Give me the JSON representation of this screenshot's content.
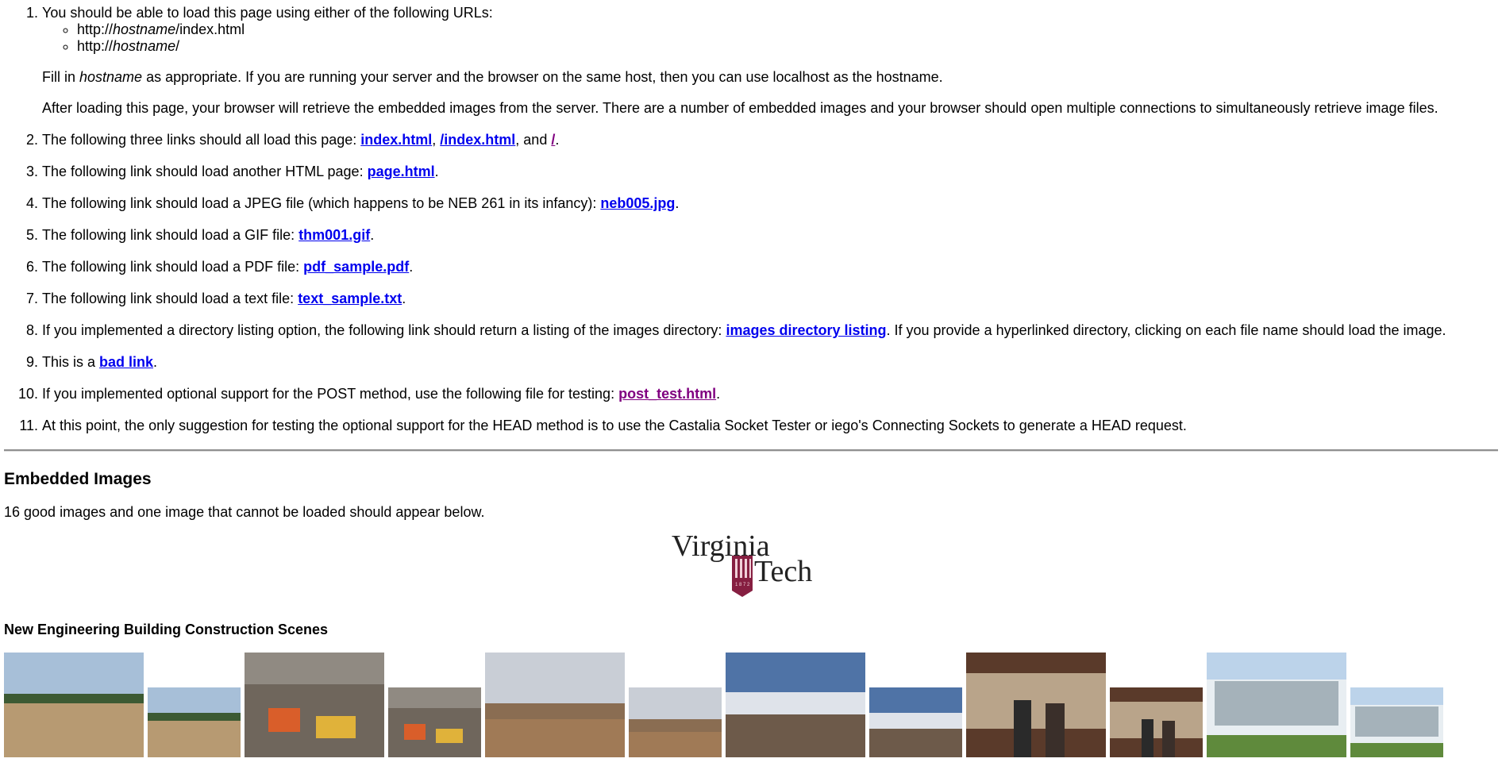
{
  "list": {
    "item1": {
      "text": "You should be able to load this page using either of the following URLs:",
      "urls": [
        {
          "prefix": "http://",
          "host": "hostname",
          "suffix": "/index.html"
        },
        {
          "prefix": "http://",
          "host": "hostname",
          "suffix": "/"
        }
      ],
      "fill_pre": "Fill in ",
      "fill_em": "hostname",
      "fill_post": " as appropriate. If you are running your server and the browser on the same host, then you can use localhost as the hostname.",
      "after": "After loading this page, your browser will retrieve the embedded images from the server. There are a number of embedded images and your browser should open multiple connections to simultaneously retrieve image files."
    },
    "item2": {
      "text": "The following three links should all load this page: ",
      "link1": "index.html",
      "sep1": ", ",
      "link2": "/index.html",
      "sep2": ", and ",
      "link3": "/",
      "end": "."
    },
    "item3": {
      "text": "The following link should load another HTML page: ",
      "link": "page.html",
      "end": "."
    },
    "item4": {
      "text": "The following link should load a JPEG file (which happens to be NEB 261 in its infancy): ",
      "link": "neb005.jpg",
      "end": "."
    },
    "item5": {
      "text": "The following link should load a GIF file: ",
      "link": "thm001.gif",
      "end": "."
    },
    "item6": {
      "text": "The following link should load a PDF file: ",
      "link": "pdf_sample.pdf",
      "end": "."
    },
    "item7": {
      "text": "The following link should load a text file: ",
      "link": "text_sample.txt",
      "end": "."
    },
    "item8": {
      "text": "If you implemented a directory listing option, the following link should return a listing of the images directory: ",
      "link": "images directory listing",
      "end": ". If you provide a hyperlinked directory, clicking on each file name should load the image."
    },
    "item9": {
      "text": "This is a ",
      "link": "bad link",
      "end": "."
    },
    "item10": {
      "text": "If you implemented optional support for the POST method, use the following file for testing: ",
      "link": "post_test.html",
      "end": "."
    },
    "item11": {
      "text": "At this point, the only suggestion for testing the optional support for the HEAD method is to use the Castalia Socket Tester or iego's Connecting Sockets to generate a HEAD request."
    }
  },
  "embedded": {
    "heading": "Embedded Images",
    "description": "16 good images and one image that cannot be loaded should appear below."
  },
  "logo": {
    "line1": "Virginia",
    "line2": "Tech",
    "year": "1 8 7 2"
  },
  "gallery": {
    "heading": "New Engineering Building Construction Scenes"
  },
  "colors": {
    "link": "#0000ee",
    "visited": "#800080",
    "logo_maroon": "#861f41"
  }
}
